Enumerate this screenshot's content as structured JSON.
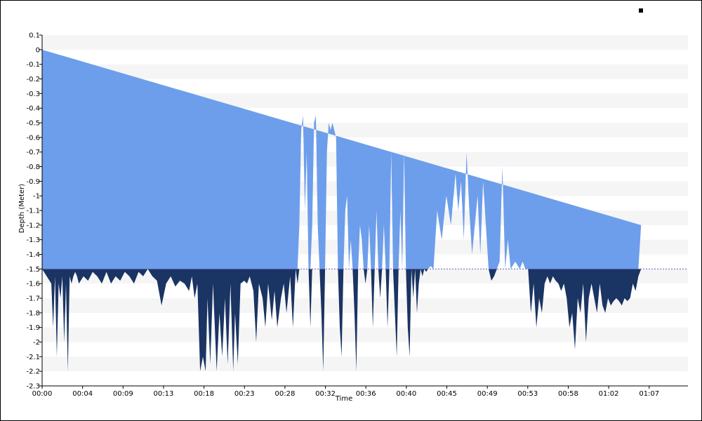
{
  "chart_data": {
    "type": "area",
    "xlabel": "Time",
    "ylabel": "Depth (Meter)",
    "ylim": [
      -2.3,
      0.1
    ],
    "x_tick_labels": [
      "00:00",
      "00:04",
      "00:09",
      "00:13",
      "00:18",
      "00:23",
      "00:28",
      "00:32",
      "00:36",
      "00:40",
      "00:45",
      "00:49",
      "00:53",
      "00:58",
      "01:02",
      "01:07"
    ],
    "y_tick_labels": [
      "0.1",
      "0",
      "-0.1",
      "-0.2",
      "-0.3",
      "-0.4",
      "-0.5",
      "-0.6",
      "-0.7",
      "-0.8",
      "-0.9",
      "-1",
      "-1.1",
      "-1.2",
      "-1.3",
      "-1.4",
      "-1.5",
      "-1.6",
      "-1.7",
      "-1.8",
      "-1.9",
      "-2",
      "-2.1",
      "-2.2",
      "-2.3"
    ],
    "x_range_minutes": [
      0,
      70.3
    ],
    "reference_depth": -1.5,
    "grid_bands": true,
    "colors": {
      "area_above_ref": "#6d9eeb",
      "area_below_ref": "#1a3463",
      "reference_line": "#6a5acd",
      "band": "#f5f5f5"
    },
    "depth_profile": {
      "x_minutes": [
        0,
        0.5,
        1,
        1.2,
        1.4,
        1.6,
        1.8,
        2,
        2.2,
        2.4,
        2.6,
        2.8,
        3,
        3.2,
        3.4,
        3.6,
        3.8,
        4,
        4.5,
        5,
        5.5,
        6,
        6.5,
        7,
        7.5,
        8,
        8.5,
        9,
        9.5,
        10,
        10.5,
        11,
        11.5,
        12,
        12.5,
        13,
        13.5,
        14,
        14.5,
        15,
        15.5,
        16,
        16.3,
        16.6,
        16.9,
        17.2,
        17.5,
        17.8,
        18,
        18.3,
        18.6,
        19,
        19.3,
        19.6,
        19.9,
        20.2,
        20.5,
        20.8,
        21,
        21.3,
        21.6,
        22,
        22.3,
        22.6,
        23,
        23.3,
        23.6,
        24,
        24.3,
        24.6,
        25,
        25.3,
        25.6,
        26,
        26.3,
        26.6,
        27,
        27.3,
        27.6,
        27.8,
        28,
        28.2,
        28.4,
        28.6,
        28.8,
        29,
        29.2,
        29.4,
        29.6,
        29.8,
        30,
        30.2,
        30.4,
        30.6,
        30.8,
        31,
        31.2,
        31.4,
        31.6,
        31.8,
        32,
        32.2,
        32.4,
        32.6,
        32.8,
        33,
        33.2,
        33.4,
        33.6,
        33.8,
        34,
        34.2,
        34.4,
        34.6,
        34.8,
        35,
        35.2,
        35.4,
        35.6,
        35.8,
        36,
        36.2,
        36.4,
        36.6,
        36.8,
        37,
        37.2,
        37.4,
        37.6,
        37.8,
        38,
        38.2,
        38.4,
        38.6,
        38.8,
        39,
        39.2,
        39.4,
        39.6,
        39.8,
        40,
        40.2,
        40.4,
        40.6,
        40.8,
        41,
        41.2,
        41.4,
        41.6,
        41.8,
        42,
        42.3,
        42.6,
        43,
        43.5,
        44,
        44.5,
        45,
        45.3,
        45.6,
        45.9,
        46.2,
        46.5,
        46.8,
        47.1,
        47.4,
        47.7,
        48,
        48.3,
        48.6,
        48.9,
        49.2,
        49.5,
        49.8,
        50.1,
        50.4,
        50.7,
        51,
        51.5,
        52,
        52.3,
        52.6,
        52.9,
        53.2,
        53.5,
        53.8,
        54.1,
        54.4,
        54.7,
        55,
        55.3,
        55.6,
        55.9,
        56.2,
        56.5,
        56.8,
        57.1,
        57.4,
        57.7,
        58,
        58.3,
        58.6,
        58.9,
        59.2,
        59.5,
        59.8,
        60.1,
        60.4,
        60.7,
        61,
        61.3,
        61.6,
        61.9,
        62.2,
        62.5,
        62.8,
        63.1,
        63.4,
        63.7,
        64,
        64.3,
        64.6,
        64.9,
        65.2,
        65.5,
        65.8,
        66.1,
        66.4,
        66.7,
        67,
        67.3,
        67.6,
        67.9,
        68.2,
        68.5,
        68.8,
        69.1,
        69.4,
        69.7,
        70,
        70.3
      ],
      "depth_m": [
        -1.5,
        -1.55,
        -1.6,
        -1.9,
        -1.55,
        -2.1,
        -1.6,
        -1.7,
        -1.55,
        -2.0,
        -1.6,
        -2.2,
        -1.55,
        -1.6,
        -1.55,
        -1.52,
        -1.55,
        -1.6,
        -1.55,
        -1.58,
        -1.52,
        -1.55,
        -1.6,
        -1.52,
        -1.6,
        -1.55,
        -1.58,
        -1.52,
        -1.55,
        -1.6,
        -1.52,
        -1.55,
        -1.5,
        -1.55,
        -1.58,
        -1.75,
        -1.6,
        -1.55,
        -1.62,
        -1.58,
        -1.6,
        -1.65,
        -1.55,
        -1.7,
        -1.6,
        -2.2,
        -2.1,
        -2.2,
        -1.7,
        -2.15,
        -1.6,
        -2.2,
        -1.8,
        -2.1,
        -1.7,
        -2.15,
        -1.6,
        -2.2,
        -1.8,
        -2.15,
        -1.6,
        -1.58,
        -1.6,
        -1.55,
        -1.65,
        -2.0,
        -1.6,
        -1.7,
        -1.9,
        -1.6,
        -1.85,
        -1.65,
        -1.9,
        -1.7,
        -1.6,
        -1.8,
        -1.55,
        -1.9,
        -1.5,
        -1.6,
        -1.2,
        -0.55,
        -0.45,
        -1.1,
        -0.7,
        -1.5,
        -1.9,
        -1.2,
        -0.5,
        -0.45,
        -1.2,
        -1.5,
        -1.8,
        -2.2,
        -1.5,
        -0.7,
        -0.5,
        -0.55,
        -0.5,
        -0.55,
        -0.6,
        -1.5,
        -1.9,
        -2.1,
        -1.5,
        -1.1,
        -1.0,
        -1.5,
        -1.3,
        -1.5,
        -1.8,
        -2.2,
        -1.5,
        -1.2,
        -1.3,
        -1.5,
        -1.6,
        -1.5,
        -1.2,
        -1.5,
        -1.9,
        -1.5,
        -1.1,
        -1.5,
        -1.7,
        -1.5,
        -1.2,
        -1.5,
        -1.9,
        -1.5,
        -0.7,
        -1.5,
        -1.8,
        -2.1,
        -1.5,
        -1.1,
        -1.5,
        -0.7,
        -1.5,
        -1.9,
        -2.1,
        -1.5,
        -1.7,
        -1.5,
        -1.8,
        -1.6,
        -1.5,
        -1.55,
        -1.5,
        -1.52,
        -1.5,
        -1.48,
        -1.5,
        -1.1,
        -1.3,
        -1.0,
        -1.2,
        -0.85,
        -1.1,
        -0.9,
        -1.3,
        -0.7,
        -1.1,
        -1.4,
        -1.2,
        -1.0,
        -1.4,
        -0.9,
        -1.2,
        -1.5,
        -1.58,
        -1.55,
        -1.5,
        -1.45,
        -0.8,
        -1.5,
        -1.3,
        -1.5,
        -1.45,
        -1.5,
        -1.45,
        -1.5,
        -1.5,
        -1.8,
        -1.6,
        -1.9,
        -1.7,
        -1.8,
        -1.6,
        -1.55,
        -1.6,
        -1.55,
        -1.58,
        -1.6,
        -1.65,
        -1.6,
        -1.7,
        -1.9,
        -1.8,
        -2.05,
        -1.7,
        -1.8,
        -1.6,
        -2.0,
        -1.7,
        -1.6,
        -1.7,
        -1.8,
        -1.6,
        -1.75,
        -1.8,
        -1.7,
        -1.75,
        -1.72,
        -1.7,
        -1.72,
        -1.75,
        -1.7,
        -1.72,
        -1.7,
        -1.6,
        -1.65,
        -1.55,
        -1.2
      ]
    }
  }
}
